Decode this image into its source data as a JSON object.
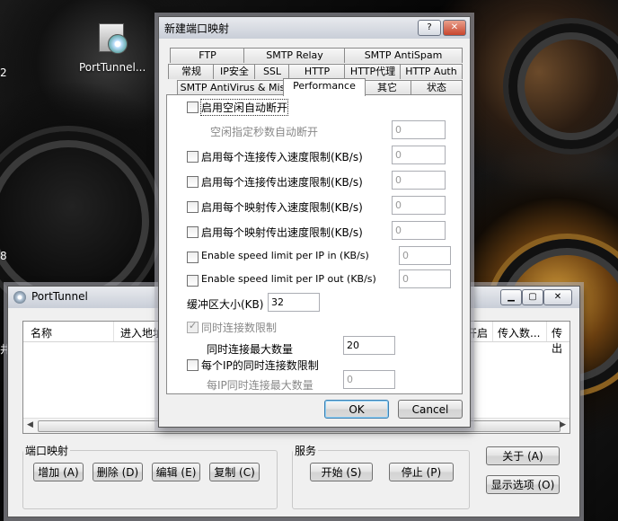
{
  "desktop": {
    "icon_label": "PortTunnel...",
    "edge_chars": [
      "2",
      "8",
      "井"
    ]
  },
  "main_window": {
    "title": "PortTunnel",
    "controls": [
      "minimize",
      "maximize",
      "close"
    ],
    "list": {
      "columns": [
        "名称",
        "进入地址",
        "开启",
        "传入数...",
        "传出"
      ]
    },
    "groups": {
      "port_mapping": {
        "label": "端口映射",
        "buttons": [
          "增加 (A)",
          "删除 (D)",
          "编辑 (E)",
          "复制 (C)"
        ]
      },
      "service": {
        "label": "服务",
        "buttons": [
          "开始 (S)",
          "停止 (P)"
        ]
      }
    },
    "side_buttons": [
      "关于 (A)",
      "显示选项 (O)"
    ]
  },
  "dialog": {
    "title": "新建端口映射",
    "help_button": "?",
    "close_button": "✕",
    "tab_rows": [
      [
        "FTP",
        "SMTP Relay",
        "SMTP AntiSpam"
      ],
      [
        "常规",
        "IP安全",
        "SSL",
        "HTTP",
        "HTTP代理",
        "HTTP Auth"
      ],
      [
        "SMTP AntiVirus & Misc",
        "Performance",
        "其它",
        "状态"
      ]
    ],
    "active_tab": "Performance",
    "options": [
      {
        "label": "启用空闲自动断开",
        "checked": false,
        "disabled": false
      },
      {
        "label": "空闲指定秒数自动断开",
        "value": "0",
        "disabled": true
      },
      {
        "label": "启用每个连接传入速度限制(KB/s)",
        "checked": false,
        "value": "0"
      },
      {
        "label": "启用每个连接传出速度限制(KB/s)",
        "checked": false,
        "value": "0"
      },
      {
        "label": "启用每个映射传入速度限制(KB/s)",
        "checked": false,
        "value": "0"
      },
      {
        "label": "启用每个映射传出速度限制(KB/s)",
        "checked": false,
        "value": "0"
      },
      {
        "label": "Enable speed limit per IP in (KB/s)",
        "checked": false,
        "value": "0"
      },
      {
        "label": "Enable speed limit per IP out (KB/s)",
        "checked": false,
        "value": "0"
      }
    ],
    "buffer": {
      "label": "缓冲区大小(KB)",
      "value": "32"
    },
    "concurrent": {
      "label": "同时连接数限制",
      "checked": true,
      "disabled": true
    },
    "max_concurrent": {
      "label": "同时连接最大数量",
      "value": "20"
    },
    "per_ip_limit": {
      "label": "每个IP的同时连接数限制",
      "checked": false
    },
    "per_ip_max": {
      "label": "每IP同时连接最大数量",
      "value": "0",
      "disabled": true
    },
    "ok_label": "OK",
    "cancel_label": "Cancel"
  }
}
